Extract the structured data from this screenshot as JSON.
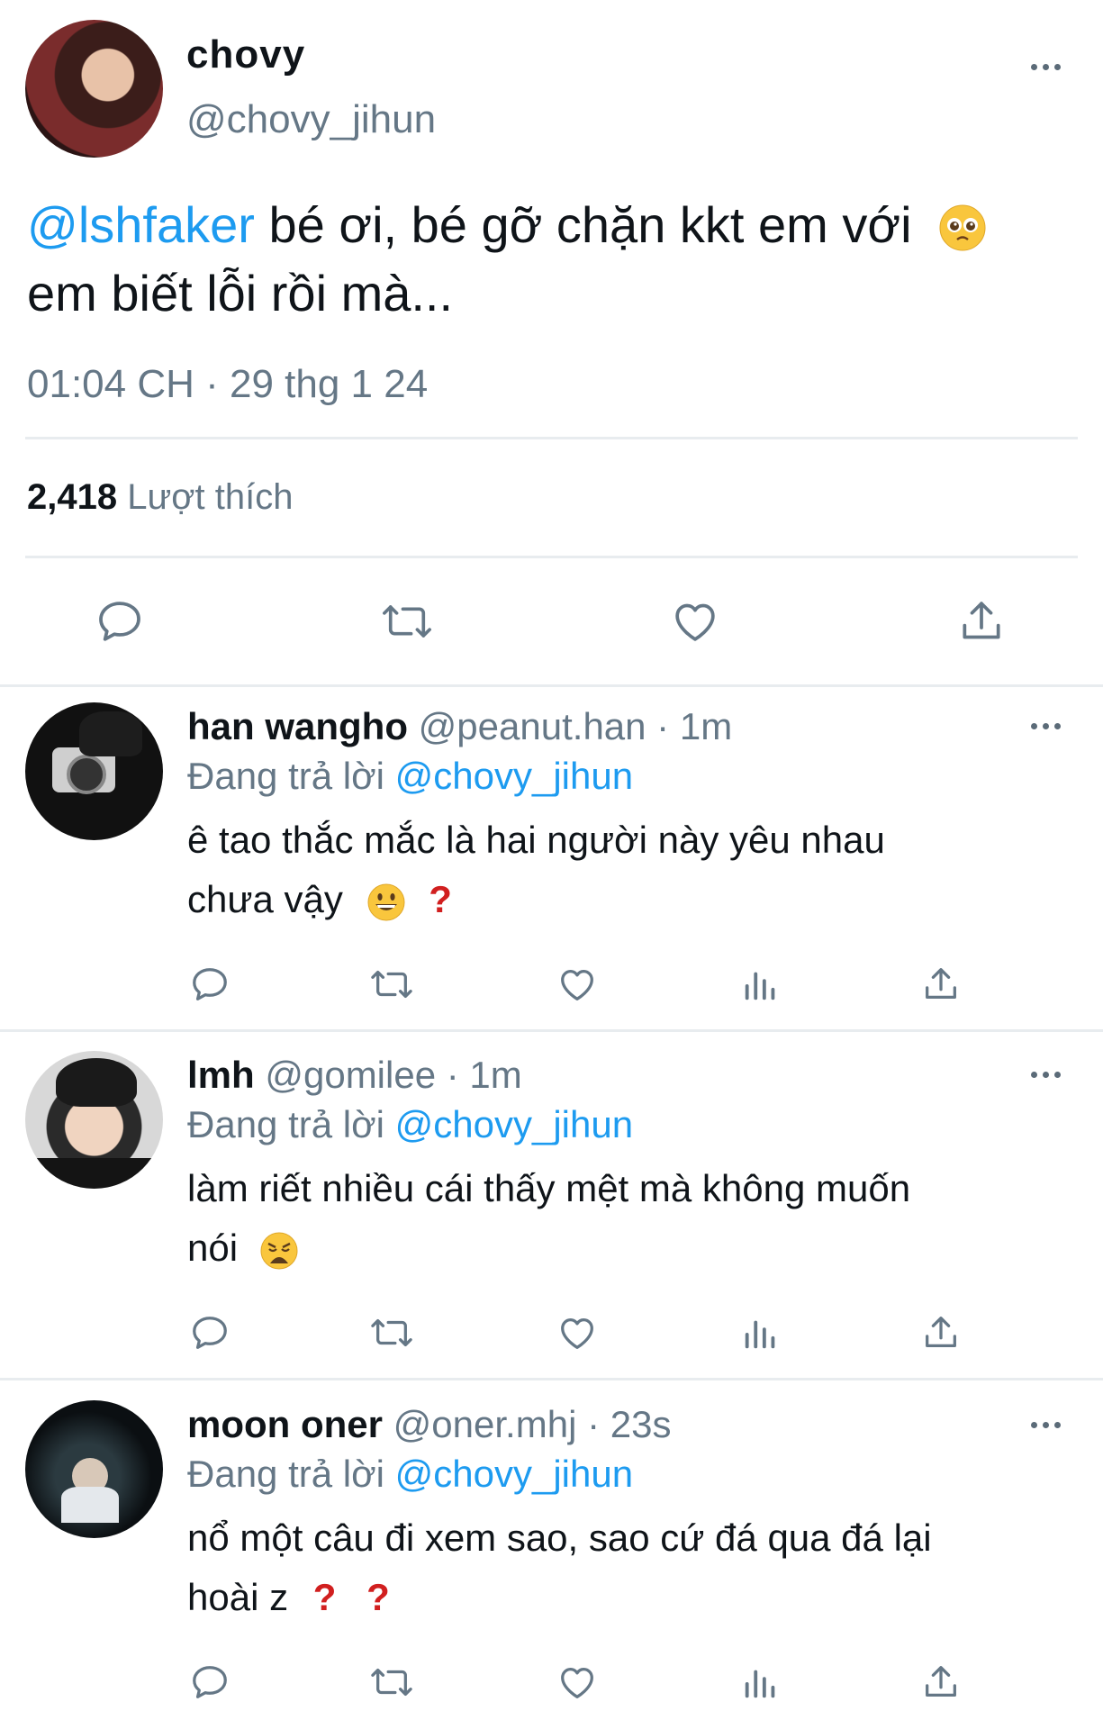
{
  "main_tweet": {
    "name": "chovy",
    "handle": "@chovy_jihun",
    "mention": "@lshfaker",
    "text_line1": " bé ơi, bé gỡ chặn kkt em với",
    "text_line2": "em biết lỗi rồi mà...",
    "timestamp": "01:04 CH · 29 thg 1 24",
    "likes_count": "2,418",
    "likes_label": "Lượt thích",
    "emoji": "pleading-face-emoji"
  },
  "reply_prefix": "Đang trả lời",
  "replies": [
    {
      "name": "han wangho",
      "meta": "@peanut.han · 1m",
      "reply_to": "@chovy_jihun",
      "line1": "ê tao thắc mắc là hai người này yêu nhau",
      "line2": "chưa vậy",
      "emoji": "grinning-face-emoji",
      "question_marks": [
        "?"
      ]
    },
    {
      "name": "lmh",
      "meta": "@gomilee · 1m",
      "reply_to": "@chovy_jihun",
      "line1": "làm riết nhiều cái thấy mệt mà không muốn",
      "line2": "nói",
      "emoji": "weary-face-emoji",
      "question_marks": []
    },
    {
      "name": "moon oner",
      "meta": "@oner.mhj · 23s",
      "reply_to": "@chovy_jihun",
      "line1": "nổ một câu đi xem sao, sao cứ đá qua đá lại",
      "line2": "hoài z",
      "emoji": "",
      "question_marks": [
        "?",
        "?"
      ]
    }
  ],
  "colors": {
    "link": "#1d9bf0",
    "muted": "#657786",
    "text": "#0f1419",
    "question_mark": "#d11f1f"
  }
}
